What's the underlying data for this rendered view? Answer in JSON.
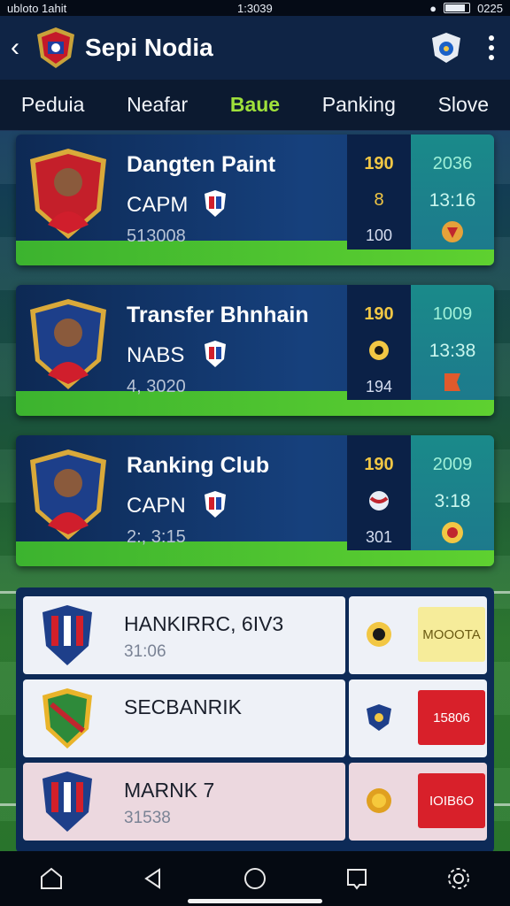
{
  "status_bar": {
    "left": "ubloto 1ahit",
    "time": "1:3039",
    "clock": "0225"
  },
  "header": {
    "title": "Sepi Nodia"
  },
  "tabs": [
    {
      "label": "Peduia"
    },
    {
      "label": "Neafar"
    },
    {
      "label": "Baue",
      "active": true
    },
    {
      "label": "Panking"
    },
    {
      "label": "Slove"
    }
  ],
  "players": [
    {
      "name": "Dangten Paint",
      "role": "CAPM",
      "date": "513008",
      "stat_a": "190",
      "stat_b": "8",
      "stat_c": "100",
      "right_a": "2036",
      "right_b": "13:16"
    },
    {
      "name": "Transfer Bhnhain",
      "role": "NABS",
      "date": "4, 3020",
      "stat_a": "190",
      "stat_b": "",
      "stat_c": "194",
      "right_a": "1009",
      "right_b": "13:38"
    },
    {
      "name": "Ranking Club",
      "role": "CAPN",
      "date": "2:, 3:15",
      "stat_a": "190",
      "stat_b": "",
      "stat_c": "301",
      "right_a": "2009",
      "right_b": "3:18"
    }
  ],
  "clubs": [
    {
      "name": "HANKIRRC, 6IV3",
      "code": "31:06",
      "tag": "MOOOTA",
      "tag_color": "#f6ec9a"
    },
    {
      "name": "SECBANRIK",
      "code": "",
      "tag": "15806",
      "tag_color": "#d8202a"
    },
    {
      "name": "MARNK 7",
      "code": "31538",
      "tag": "IOIB6O",
      "tag_color": "#d8202a"
    }
  ],
  "colors": {
    "accent": "#9fe03b",
    "header_bg": "#0f2445",
    "card_green": "#3cb32f",
    "gold": "#f2c744"
  },
  "icons": {
    "back": "chevron-left-icon",
    "club": "club-crest-icon",
    "kebab": "more-vert-icon",
    "nav": [
      "home-icon",
      "back-icon",
      "circle-home-icon",
      "recent-apps-icon",
      "settings-icon"
    ]
  }
}
